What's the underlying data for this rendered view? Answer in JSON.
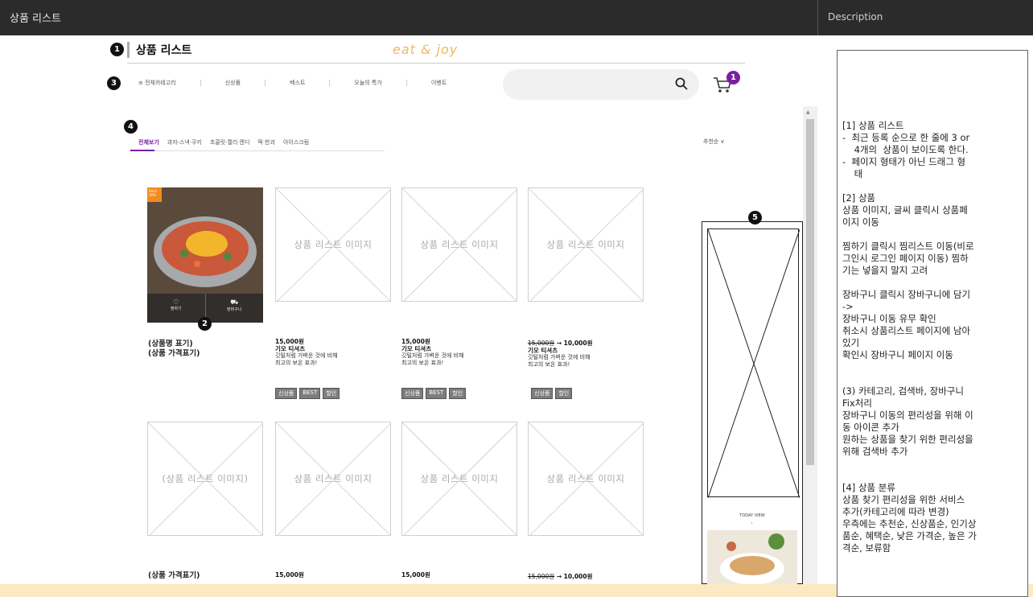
{
  "window": {
    "title": "상품 리스트",
    "desc_title": "Description"
  },
  "header": {
    "page_title": "상품 리스트",
    "logo": "eat & joy",
    "nav": [
      "≡ 전체카테고리",
      "신상품",
      "베스트",
      "오늘의 특가",
      "이벤트"
    ],
    "cart_count": "1"
  },
  "badges": {
    "b1": "1",
    "b2": "2",
    "b3": "3",
    "b4": "4",
    "b5": "5"
  },
  "categories": {
    "items": [
      "전체보기",
      "과자·스낵·쿠키",
      "초콜릿·젤리·캔디",
      "떡·한과",
      "아이스크림"
    ],
    "sort": "추천순 ∨"
  },
  "product_row1": {
    "p1": {
      "line1": "(상품명 표기)",
      "line2": "(상품 가격표기)",
      "wish": "찜하기",
      "cart": "장바구니",
      "sale": "SALE 20%"
    },
    "p2": {
      "image_label": "상품 리스트 이미지",
      "price": "15,000원",
      "name": "기모 티셔츠",
      "desc1": "깃털처럼 가벼운 것에 비해",
      "desc2": "최고의 보온 효과!",
      "tags": [
        "신상품",
        "BEST",
        "할인"
      ]
    },
    "p3": {
      "image_label": "상품 리스트 이미지",
      "price": "15,000원",
      "name": "기모 티셔츠",
      "desc1": "깃털처럼 가벼운 것에 비해",
      "desc2": "최고의 보온 효과!",
      "tags": [
        "신상품",
        "BEST",
        "할인"
      ]
    },
    "p4": {
      "image_label": "상품 리스트 이미지",
      "old_price": "15,000원",
      "arrow_price": "→ 10,000원",
      "name": "기모 티셔츠",
      "desc1": "깃털처럼 가벼운 것에 비해",
      "desc2": "최고의 보온 효과!",
      "tags": [
        "신상품",
        "할인"
      ]
    }
  },
  "product_row2": {
    "p1": {
      "image_label": "(상품 리스트 이미지)",
      "line1": "(상품 가격표기)"
    },
    "p2": {
      "image_label": "상품 리스트 이미지",
      "price": "15,000원"
    },
    "p3": {
      "image_label": "상품 리스트 이미지",
      "price": "15,000원"
    },
    "p4": {
      "image_label": "상품 리스트 이미지",
      "old_price": "15,000원",
      "arrow_price": "→ 10,000원"
    }
  },
  "side_banner": {
    "today_view": "TODAY VIEW"
  },
  "description": "[1] 상품 리스트\n-  최근 등록 순으로 한 줄에 3 or\n    4개의  상품이 보이도록 한다.\n-  페이지 형태가 아닌 드래그 형\n    태\n\n[2] 상품\n상품 이미지, 글씨 클릭시 상품페\n이지 이동\n\n찜하기 클릭시 찜리스트 이동(비로\n그인시 로그인 페이지 이동) 찜하\n기는 넣을지 말지 고려\n\n장바구니 클릭시 장바구니에 담기\n->\n장바구니 이동 유무 확인\n취소시 상품리스트 페이지에 남아\n있기\n확인시 장바구니 페이지 이동\n\n\n(3) 카테고리, 검색바, 장바구니\nFix처리\n장바구니 이동의 편리성을 위해 이\n동 아이콘 추가\n원하는 상품을 찾기 위한 편리성을\n위해 검색바 추가\n\n\n[4] 상품 분류\n상품 찾기 편리성을 위한 서비스\n추가(카테고리에 따라 변경)\n우측에는 추천순, 신상품순, 인기상\n품순, 혜택순, 낮은 가격순, 높은 가\n격순, 보류함"
}
